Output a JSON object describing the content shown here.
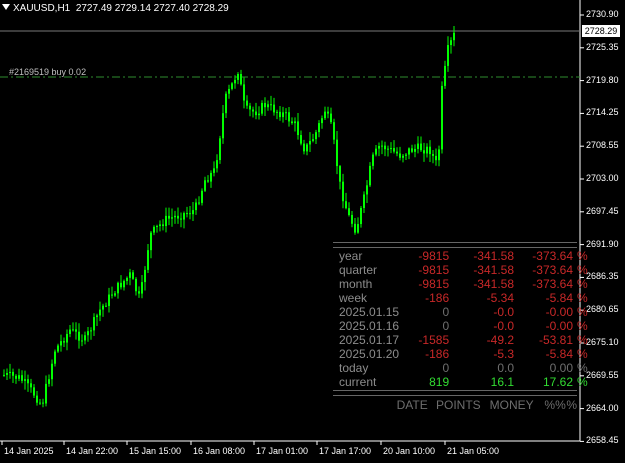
{
  "header": {
    "symbol": "XAUUSD,H1",
    "ohlc": "2727.49 2729.14 2727.40 2728.29"
  },
  "order_line": {
    "label": "#2169519 buy 0.02"
  },
  "current_price": "2728.29",
  "colors": {
    "background": "#000000",
    "candle": "#00ff00",
    "order_line": "#2e8b2e",
    "axis": "#ffffff",
    "negative": "#c82828",
    "positive": "#32dc32",
    "muted": "#6e6e6e"
  },
  "y_ticks": [
    "2730.90",
    "2725.35",
    "2719.80",
    "2714.25",
    "2708.55",
    "2703.00",
    "2697.45",
    "2691.90",
    "2686.35",
    "2680.65",
    "2675.10",
    "2669.55",
    "2664.00",
    "2658.45"
  ],
  "x_ticks": [
    "14 Jan 2025",
    "14 Jan 22:00",
    "15 Jan 15:00",
    "16 Jan 08:00",
    "17 Jan 01:00",
    "17 Jan 17:00",
    "20 Jan 10:00",
    "21 Jan 05:00"
  ],
  "stats": {
    "rows": [
      {
        "label": "year",
        "points": "-9815",
        "money": "-341.58",
        "pct": "-373.64",
        "suffix": "%",
        "tone": "neg"
      },
      {
        "label": "quarter",
        "points": "-9815",
        "money": "-341.58",
        "pct": "-373.64",
        "suffix": "%",
        "tone": "neg"
      },
      {
        "label": "month",
        "points": "-9815",
        "money": "-341.58",
        "pct": "-373.64",
        "suffix": "%",
        "tone": "neg"
      },
      {
        "label": "week",
        "points": "-186",
        "money": "-5.34",
        "pct": "-5.84",
        "suffix": "%",
        "tone": "neg"
      },
      {
        "label": "2025.01.15",
        "points": "0",
        "money": "-0.0",
        "pct": "-0.00",
        "suffix": "%",
        "tone": "mixed"
      },
      {
        "label": "2025.01.16",
        "points": "0",
        "money": "-0.0",
        "pct": "-0.00",
        "suffix": "%",
        "tone": "mixed"
      },
      {
        "label": "2025.01.17",
        "points": "-1585",
        "money": "-49.2",
        "pct": "-53.81",
        "suffix": "%",
        "tone": "neg"
      },
      {
        "label": "2025.01.20",
        "points": "-186",
        "money": "-5.3",
        "pct": "-5.84",
        "suffix": "%",
        "tone": "neg"
      },
      {
        "label": "today",
        "points": "0",
        "money": "0.0",
        "pct": "0.00",
        "suffix": "%",
        "tone": "zero"
      },
      {
        "label": "current",
        "points": "819",
        "money": "16.1",
        "pct": "17.62",
        "suffix": "%",
        "tone": "pos"
      }
    ],
    "legend": {
      "date": "DATE",
      "points": "POINTS",
      "money": "MONEY",
      "pct": "%%",
      "suffix": "%"
    }
  }
}
